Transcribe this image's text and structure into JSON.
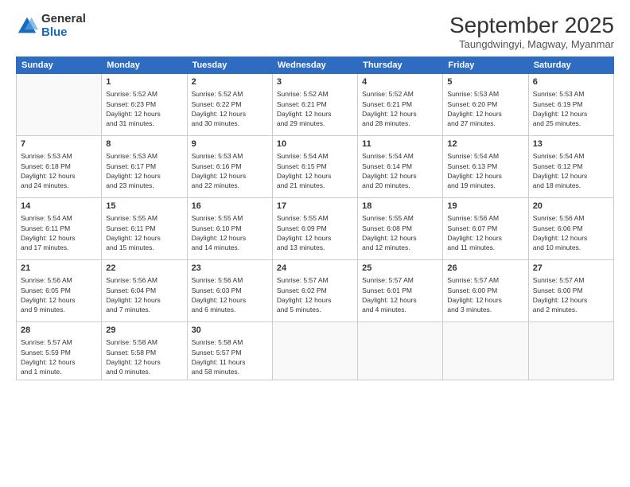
{
  "logo": {
    "general": "General",
    "blue": "Blue"
  },
  "title": "September 2025",
  "subtitle": "Taungdwingyi, Magway, Myanmar",
  "weekdays": [
    "Sunday",
    "Monday",
    "Tuesday",
    "Wednesday",
    "Thursday",
    "Friday",
    "Saturday"
  ],
  "weeks": [
    [
      {
        "day": "",
        "info": ""
      },
      {
        "day": "1",
        "info": "Sunrise: 5:52 AM\nSunset: 6:23 PM\nDaylight: 12 hours\nand 31 minutes."
      },
      {
        "day": "2",
        "info": "Sunrise: 5:52 AM\nSunset: 6:22 PM\nDaylight: 12 hours\nand 30 minutes."
      },
      {
        "day": "3",
        "info": "Sunrise: 5:52 AM\nSunset: 6:21 PM\nDaylight: 12 hours\nand 29 minutes."
      },
      {
        "day": "4",
        "info": "Sunrise: 5:52 AM\nSunset: 6:21 PM\nDaylight: 12 hours\nand 28 minutes."
      },
      {
        "day": "5",
        "info": "Sunrise: 5:53 AM\nSunset: 6:20 PM\nDaylight: 12 hours\nand 27 minutes."
      },
      {
        "day": "6",
        "info": "Sunrise: 5:53 AM\nSunset: 6:19 PM\nDaylight: 12 hours\nand 25 minutes."
      }
    ],
    [
      {
        "day": "7",
        "info": "Sunrise: 5:53 AM\nSunset: 6:18 PM\nDaylight: 12 hours\nand 24 minutes."
      },
      {
        "day": "8",
        "info": "Sunrise: 5:53 AM\nSunset: 6:17 PM\nDaylight: 12 hours\nand 23 minutes."
      },
      {
        "day": "9",
        "info": "Sunrise: 5:53 AM\nSunset: 6:16 PM\nDaylight: 12 hours\nand 22 minutes."
      },
      {
        "day": "10",
        "info": "Sunrise: 5:54 AM\nSunset: 6:15 PM\nDaylight: 12 hours\nand 21 minutes."
      },
      {
        "day": "11",
        "info": "Sunrise: 5:54 AM\nSunset: 6:14 PM\nDaylight: 12 hours\nand 20 minutes."
      },
      {
        "day": "12",
        "info": "Sunrise: 5:54 AM\nSunset: 6:13 PM\nDaylight: 12 hours\nand 19 minutes."
      },
      {
        "day": "13",
        "info": "Sunrise: 5:54 AM\nSunset: 6:12 PM\nDaylight: 12 hours\nand 18 minutes."
      }
    ],
    [
      {
        "day": "14",
        "info": "Sunrise: 5:54 AM\nSunset: 6:11 PM\nDaylight: 12 hours\nand 17 minutes."
      },
      {
        "day": "15",
        "info": "Sunrise: 5:55 AM\nSunset: 6:11 PM\nDaylight: 12 hours\nand 15 minutes."
      },
      {
        "day": "16",
        "info": "Sunrise: 5:55 AM\nSunset: 6:10 PM\nDaylight: 12 hours\nand 14 minutes."
      },
      {
        "day": "17",
        "info": "Sunrise: 5:55 AM\nSunset: 6:09 PM\nDaylight: 12 hours\nand 13 minutes."
      },
      {
        "day": "18",
        "info": "Sunrise: 5:55 AM\nSunset: 6:08 PM\nDaylight: 12 hours\nand 12 minutes."
      },
      {
        "day": "19",
        "info": "Sunrise: 5:56 AM\nSunset: 6:07 PM\nDaylight: 12 hours\nand 11 minutes."
      },
      {
        "day": "20",
        "info": "Sunrise: 5:56 AM\nSunset: 6:06 PM\nDaylight: 12 hours\nand 10 minutes."
      }
    ],
    [
      {
        "day": "21",
        "info": "Sunrise: 5:56 AM\nSunset: 6:05 PM\nDaylight: 12 hours\nand 9 minutes."
      },
      {
        "day": "22",
        "info": "Sunrise: 5:56 AM\nSunset: 6:04 PM\nDaylight: 12 hours\nand 7 minutes."
      },
      {
        "day": "23",
        "info": "Sunrise: 5:56 AM\nSunset: 6:03 PM\nDaylight: 12 hours\nand 6 minutes."
      },
      {
        "day": "24",
        "info": "Sunrise: 5:57 AM\nSunset: 6:02 PM\nDaylight: 12 hours\nand 5 minutes."
      },
      {
        "day": "25",
        "info": "Sunrise: 5:57 AM\nSunset: 6:01 PM\nDaylight: 12 hours\nand 4 minutes."
      },
      {
        "day": "26",
        "info": "Sunrise: 5:57 AM\nSunset: 6:00 PM\nDaylight: 12 hours\nand 3 minutes."
      },
      {
        "day": "27",
        "info": "Sunrise: 5:57 AM\nSunset: 6:00 PM\nDaylight: 12 hours\nand 2 minutes."
      }
    ],
    [
      {
        "day": "28",
        "info": "Sunrise: 5:57 AM\nSunset: 5:59 PM\nDaylight: 12 hours\nand 1 minute."
      },
      {
        "day": "29",
        "info": "Sunrise: 5:58 AM\nSunset: 5:58 PM\nDaylight: 12 hours\nand 0 minutes."
      },
      {
        "day": "30",
        "info": "Sunrise: 5:58 AM\nSunset: 5:57 PM\nDaylight: 11 hours\nand 58 minutes."
      },
      {
        "day": "",
        "info": ""
      },
      {
        "day": "",
        "info": ""
      },
      {
        "day": "",
        "info": ""
      },
      {
        "day": "",
        "info": ""
      }
    ]
  ]
}
